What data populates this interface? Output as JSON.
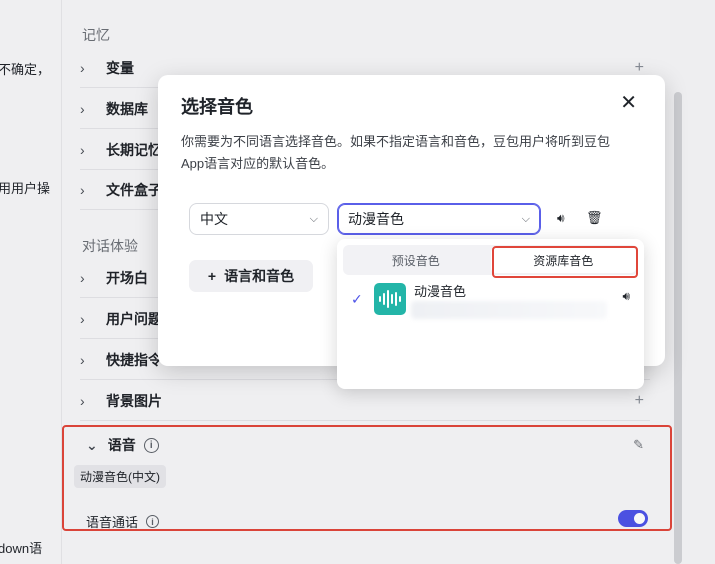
{
  "left_fragments": [
    "不确定，",
    "用用户操",
    "down语"
  ],
  "sections": {
    "memory_title": "记忆",
    "memory_items": [
      "变量",
      "数据库",
      "长期记忆",
      "文件盒子"
    ],
    "dialog_title": "对话体验",
    "dialog_items": [
      "开场白",
      "用户问题",
      "快捷指令",
      "背景图片"
    ]
  },
  "voice": {
    "title": "语音",
    "tag": "动漫音色(中文)",
    "call_label": "语音通话",
    "call_enabled": true
  },
  "modal": {
    "title": "选择音色",
    "close": "✕",
    "description": "你需要为不同语言选择音色。如果不指定语言和音色，豆包用户将听到豆包 App语言对应的默认音色。",
    "language_value": "中文",
    "voice_value": "动漫音色",
    "add_button": "语言和音色",
    "add_icon": "+"
  },
  "dropdown": {
    "tabs": [
      "预设音色",
      "资源库音色"
    ],
    "active_tab": 1,
    "option_name": "动漫音色",
    "option_selected": true
  },
  "colors": {
    "accent": "#4d53e8",
    "highlight": "#e0463a",
    "avatar": "#23b5a8"
  }
}
